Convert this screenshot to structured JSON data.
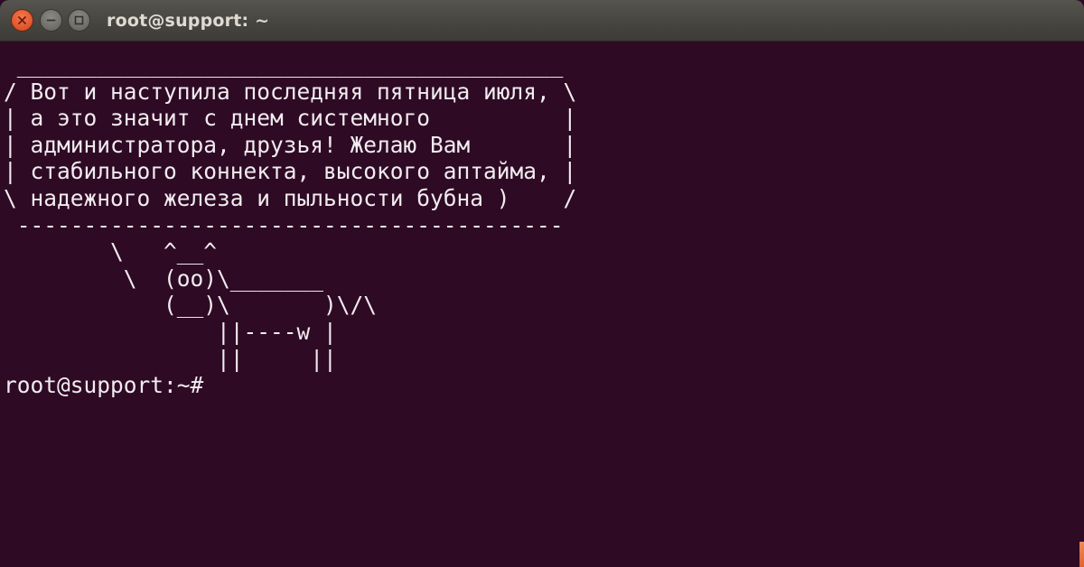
{
  "window": {
    "title": "root@support: ~",
    "buttons": [
      {
        "name": "close",
        "icon": "close-icon"
      },
      {
        "name": "minimize",
        "icon": "minimize-icon"
      },
      {
        "name": "maximize",
        "icon": "maximize-icon"
      }
    ],
    "colors": {
      "terminal_bg": "#2f0a24",
      "text": "#f0ecf0",
      "titlebar": "#4a4843",
      "close_button": "#e0532a"
    }
  },
  "terminal": {
    "output_lines": [
      " _________________________________________",
      "/ Вот и наступила последняя пятница июля, \\",
      "| а это значит с днем системного          |",
      "| администратора, друзья! Желаю Вам       |",
      "| стабильного коннекта, высокого аптайма, |",
      "\\ надежного железа и пыльности бубна )    /",
      " -----------------------------------------",
      "        \\   ^__^",
      "         \\  (oo)\\_______",
      "            (__)\\       )\\/\\",
      "                ||----w |",
      "                ||     ||"
    ],
    "prompt": "root@support:~#",
    "command": ""
  }
}
